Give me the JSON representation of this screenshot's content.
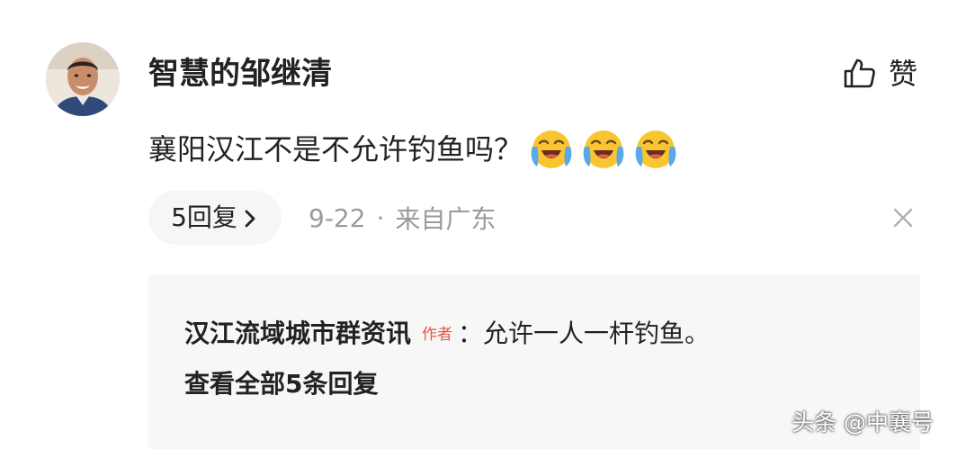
{
  "comment": {
    "username": "智慧的邹继清",
    "text": "襄阳汉江不是不允许钓鱼吗？",
    "emoji_icon": "loudly-crying-face-icon",
    "emoji_count": 3,
    "like_label": "赞",
    "reply_count_label": "5回复",
    "date": "9-22",
    "separator": "·",
    "location": "来自广东"
  },
  "reply_preview": {
    "author": "汉江流域城市群资讯",
    "author_badge": "作者",
    "text": "：允许一人一杆钓鱼。",
    "view_all_label": "查看全部5条回复"
  },
  "watermark": "头条 @中襄号",
  "colors": {
    "text_primary": "#222222",
    "text_secondary": "#9a9a9a",
    "badge": "#e8553e",
    "pill_bg": "#f6f6f6",
    "reply_bg": "#f7f7f7"
  }
}
